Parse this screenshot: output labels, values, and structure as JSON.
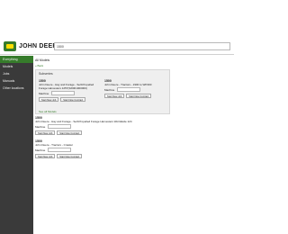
{
  "brand": {
    "name": "JOHN DEERE"
  },
  "search": {
    "value": "1500"
  },
  "sidebar": {
    "items": [
      {
        "label": "Everything"
      },
      {
        "label": "Models"
      },
      {
        "label": "Jobs"
      },
      {
        "label": "Manuals"
      },
      {
        "label": "Other locations"
      }
    ]
  },
  "main": {
    "breadcrumb": "All Models",
    "back_link": "« Back",
    "panel": {
      "title": "Subseries",
      "see_all": "See all Models",
      "cards": [
        {
          "number": "1500",
          "description": "John Deere - Hay and Forage - Self-Propelled Forage Harvesters 1257(S/#001000000)",
          "field_label": "Machine",
          "buttons": [
            "Start New Job",
            "Start New Contract"
          ]
        },
        {
          "number": "1500",
          "description": "John Deere - Tractors - 1900 to WP400",
          "field_label": "Machine",
          "buttons": [
            "Start New Job",
            "Start New Contract"
          ]
        }
      ]
    },
    "cards": [
      {
        "number": "1500",
        "description": "John Deere - Hay and Forage - Self-Propelled Forage Harvesters Worldwide 124",
        "field_label": "Machine",
        "buttons": [
          "Start New Job",
          "Start New Contract"
        ]
      },
      {
        "number": "1500",
        "description": "John Deere - Tractors - Crawler",
        "field_label": "Machine",
        "buttons": [
          "Start New Job",
          "Start New Contract"
        ]
      }
    ]
  }
}
